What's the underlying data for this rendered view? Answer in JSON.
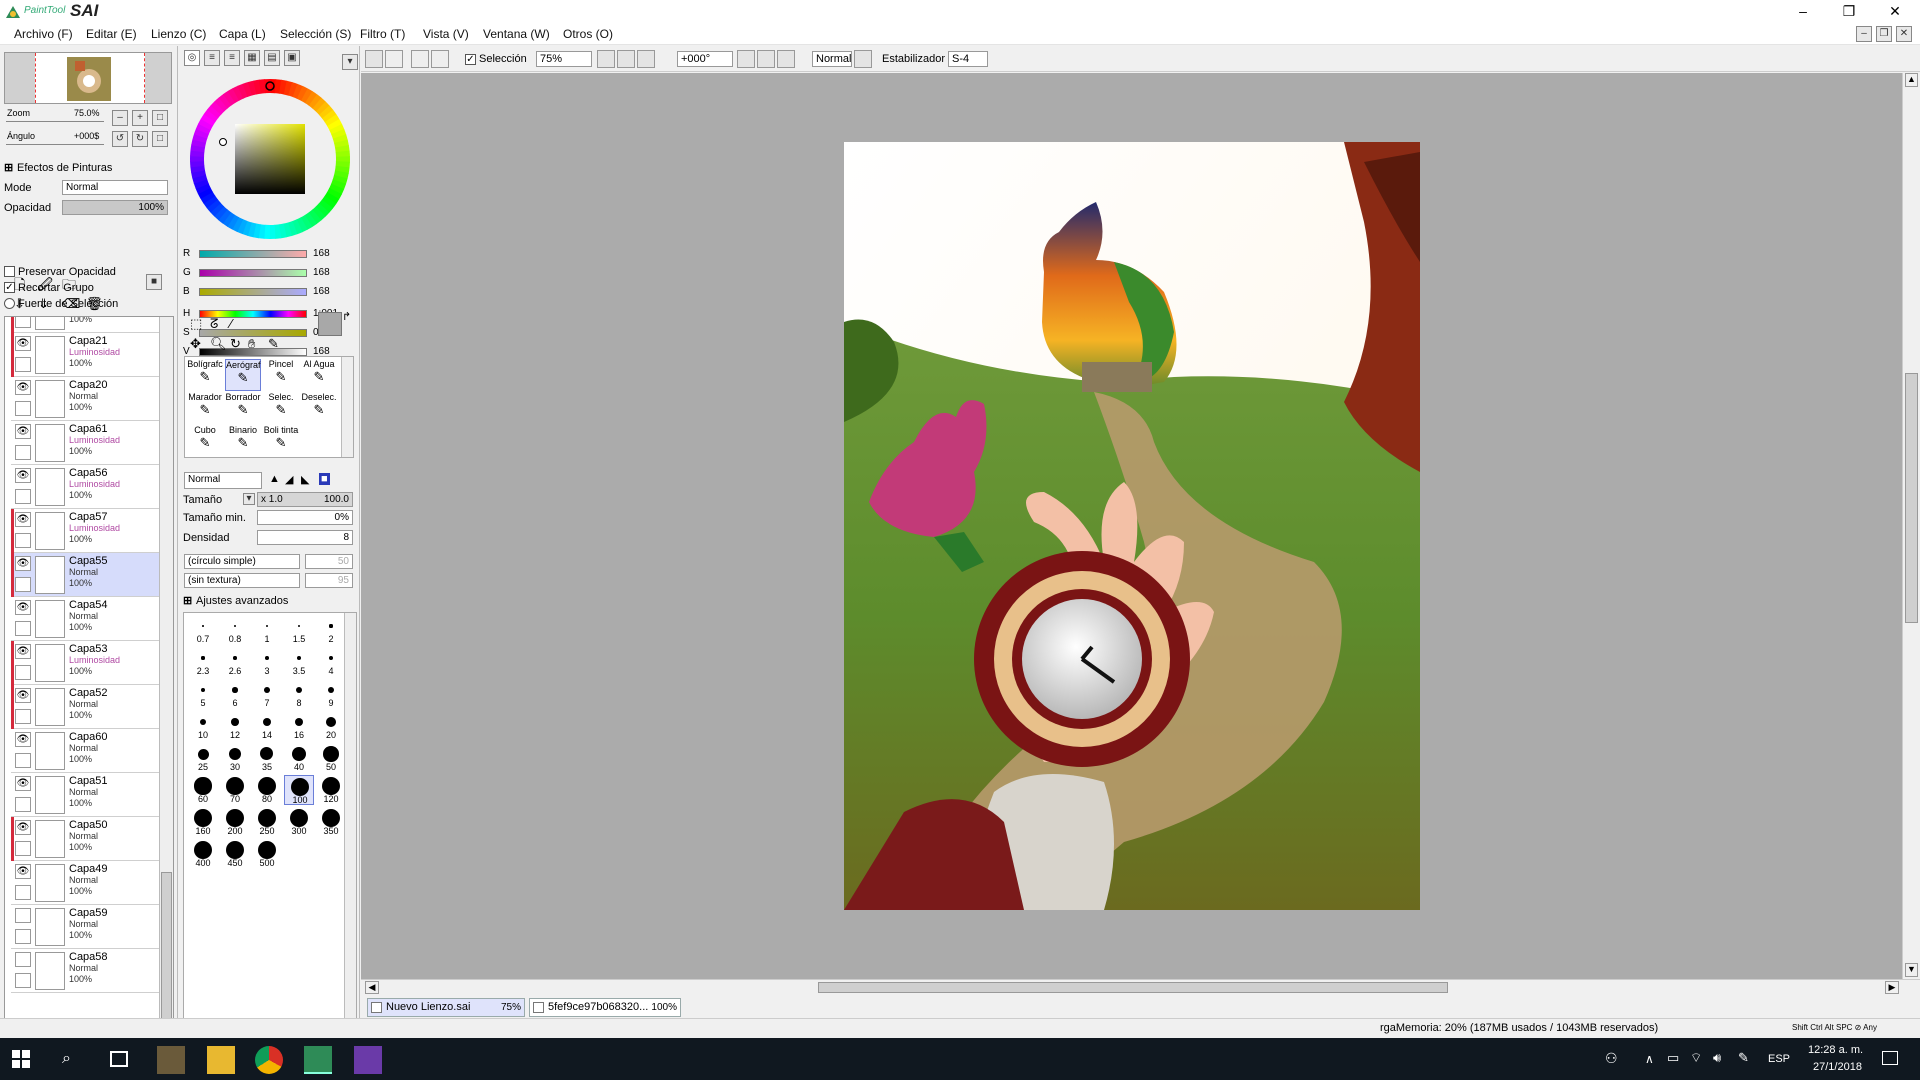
{
  "app": {
    "logo_small": "PaintTool",
    "logo_big": "SAI"
  },
  "window_controls": {
    "minimize": "–",
    "maximize": "❐",
    "close": "✕"
  },
  "menu": [
    "Archivo (F)",
    "Editar (E)",
    "Lienzo (C)",
    "Capa (L)",
    "Selección (S)",
    "Filtro (T)",
    "Vista (V)",
    "Ventana (W)",
    "Otros (O)"
  ],
  "navigator": {
    "zoom_label": "Zoom",
    "zoom_value": "75.0%",
    "angle_label": "Ángulo",
    "angle_value": "+000$"
  },
  "effects": {
    "header": "Efectos de Pinturas",
    "mode_label": "Mode",
    "mode_value": "Normal",
    "opacity_label": "Opacidad",
    "opacity_value": "100%",
    "opacity_level": 1.0
  },
  "checks": [
    {
      "label": "Preservar Opacidad",
      "checked": false
    },
    {
      "label": "Recortar Grupo",
      "checked": true
    },
    {
      "label": "Fuente de Selección",
      "checked": false
    }
  ],
  "layers": [
    {
      "name": "",
      "mode": "Normal",
      "opacity": "100%",
      "clip": true,
      "visible": false,
      "selected": false,
      "lum": false
    },
    {
      "name": "Capa21",
      "mode": "Luminosidad",
      "opacity": "100%",
      "clip": true,
      "visible": true,
      "selected": false,
      "lum": true
    },
    {
      "name": "Capa20",
      "mode": "Normal",
      "opacity": "100%",
      "clip": false,
      "visible": true,
      "selected": false,
      "lum": false
    },
    {
      "name": "Capa61",
      "mode": "Luminosidad",
      "opacity": "100%",
      "clip": false,
      "visible": true,
      "selected": false,
      "lum": true
    },
    {
      "name": "Capa56",
      "mode": "Luminosidad",
      "opacity": "100%",
      "clip": false,
      "visible": true,
      "selected": false,
      "lum": true
    },
    {
      "name": "Capa57",
      "mode": "Luminosidad",
      "opacity": "100%",
      "clip": true,
      "visible": true,
      "selected": false,
      "lum": true
    },
    {
      "name": "Capa55",
      "mode": "Normal",
      "opacity": "100%",
      "clip": true,
      "visible": true,
      "selected": true,
      "lum": false
    },
    {
      "name": "Capa54",
      "mode": "Normal",
      "opacity": "100%",
      "clip": false,
      "visible": true,
      "selected": false,
      "lum": false
    },
    {
      "name": "Capa53",
      "mode": "Luminosidad",
      "opacity": "100%",
      "clip": true,
      "visible": true,
      "selected": false,
      "lum": true
    },
    {
      "name": "Capa52",
      "mode": "Normal",
      "opacity": "100%",
      "clip": true,
      "visible": true,
      "selected": false,
      "lum": false
    },
    {
      "name": "Capa60",
      "mode": "Normal",
      "opacity": "100%",
      "clip": false,
      "visible": true,
      "selected": false,
      "lum": false
    },
    {
      "name": "Capa51",
      "mode": "Normal",
      "opacity": "100%",
      "clip": false,
      "visible": true,
      "selected": false,
      "lum": false
    },
    {
      "name": "Capa50",
      "mode": "Normal",
      "opacity": "100%",
      "clip": true,
      "visible": true,
      "selected": false,
      "lum": false
    },
    {
      "name": "Capa49",
      "mode": "Normal",
      "opacity": "100%",
      "clip": false,
      "visible": true,
      "selected": false,
      "lum": false
    },
    {
      "name": "Capa59",
      "mode": "Normal",
      "opacity": "100%",
      "clip": false,
      "visible": false,
      "selected": false,
      "lum": false
    },
    {
      "name": "Capa58",
      "mode": "Normal",
      "opacity": "100%",
      "clip": false,
      "visible": false,
      "selected": false,
      "lum": false
    }
  ],
  "color": {
    "sliders": [
      {
        "label": "R",
        "value": "168"
      },
      {
        "label": "G",
        "value": "168"
      },
      {
        "label": "B",
        "value": "168"
      },
      {
        "label": "H",
        "value": "1:001"
      },
      {
        "label": "S",
        "value": "000"
      },
      {
        "label": "V",
        "value": "168"
      }
    ],
    "current": "#a8a8a8"
  },
  "tools": [
    {
      "label": "Bolígrafc",
      "selected": false
    },
    {
      "label": "Aerógraf",
      "selected": true
    },
    {
      "label": "Pincel",
      "selected": false
    },
    {
      "label": "Al Agua",
      "selected": false
    },
    {
      "label": "Marador",
      "selected": false
    },
    {
      "label": "Borrador",
      "selected": false
    },
    {
      "label": "Selec.",
      "selected": false
    },
    {
      "label": "Deselec.",
      "selected": false
    },
    {
      "label": "Cubo",
      "selected": false
    },
    {
      "label": "Binario",
      "selected": false
    },
    {
      "label": "Boli tinta",
      "selected": false
    }
  ],
  "brush": {
    "mode": "Normal",
    "size_label": "Tamaño",
    "size_mult": "x 1.0",
    "size_value": "100.0",
    "min_label": "Tamaño min.",
    "min_value": "0%",
    "density_label": "Densidad",
    "density_value": "8",
    "shape": "(círculo simple)",
    "shape_value": "50",
    "texture": "(sin textura)",
    "texture_value": "95",
    "advanced": "Ajustes avanzados",
    "sizes": [
      "0.7",
      "0.8",
      "1",
      "1.5",
      "2",
      "2.3",
      "2.6",
      "3",
      "3.5",
      "4",
      "5",
      "6",
      "7",
      "8",
      "9",
      "10",
      "12",
      "14",
      "16",
      "20",
      "25",
      "30",
      "35",
      "40",
      "50",
      "60",
      "70",
      "80",
      "100",
      "120",
      "160",
      "200",
      "250",
      "300",
      "350",
      "400",
      "450",
      "500"
    ],
    "selected_size": "100"
  },
  "toolbar": {
    "selection_label": "Selección",
    "zoom_value": "75%",
    "angle_value": "+000°",
    "mode_value": "Normal",
    "stabilizer_label": "Estabilizador",
    "stabilizer_value": "S-4"
  },
  "tabs": [
    {
      "name": "Nuevo Lienzo.sai",
      "zoom": "75%",
      "active": true
    },
    {
      "name": "5fef9ce97b068320...",
      "zoom": "100%",
      "active": false
    }
  ],
  "status": {
    "memory": "rgaMemoria: 20% (187MB usados / 1043MB reservados)",
    "keys": "Shift Ctrl Alt SPC ⊘ Any"
  },
  "taskbar": {
    "lang": "ESP",
    "time": "12:28 a. m.",
    "date": "27/1/2018"
  }
}
